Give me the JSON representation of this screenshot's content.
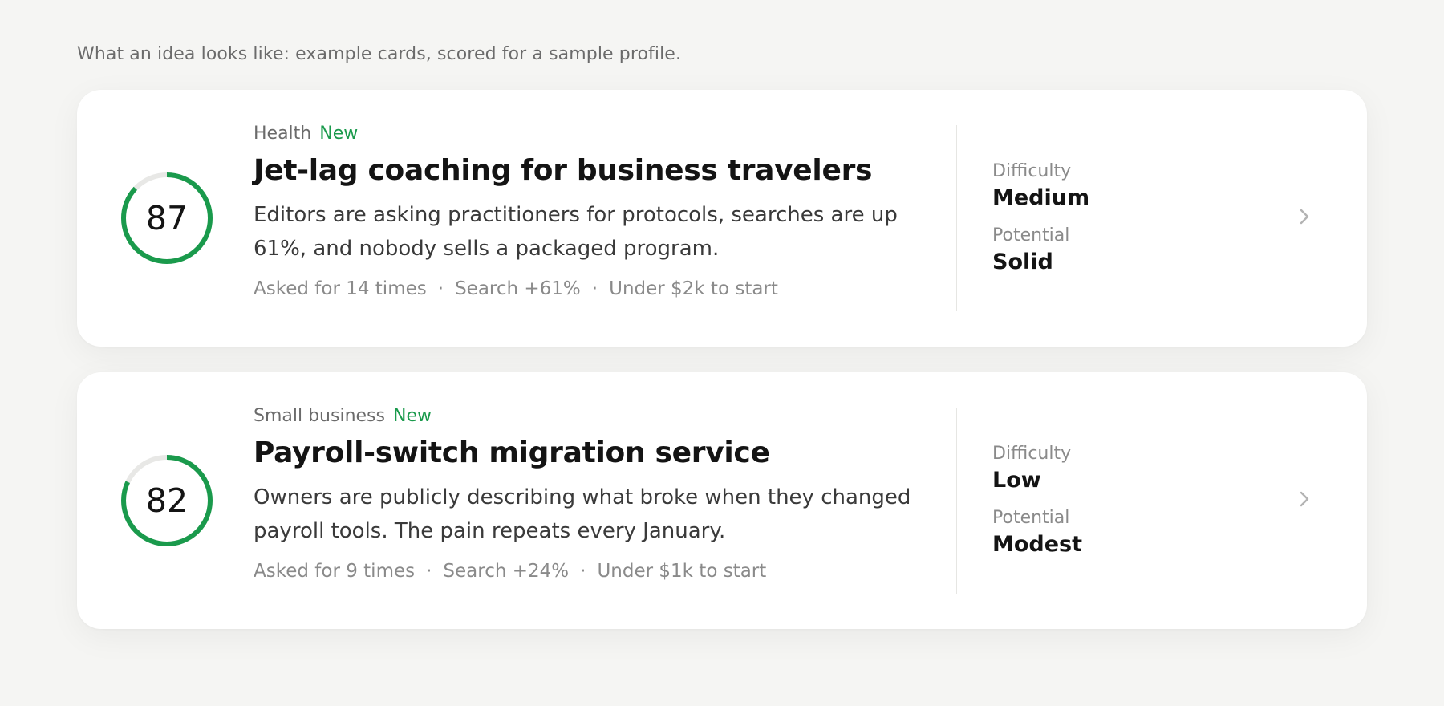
{
  "intro": "What an idea looks like: example cards, scored for a sample profile.",
  "colors": {
    "accent_green": "#1a9a4c",
    "ring_track": "#e8e8e6",
    "background": "#f5f5f3"
  },
  "labels": {
    "difficulty": "Difficulty",
    "potential": "Potential",
    "separator": "·"
  },
  "icons": {
    "open": "chevron-right-icon"
  },
  "cards": [
    {
      "score": 87,
      "category": "Health",
      "badge": "New",
      "title": "Jet-lag coaching for business travelers",
      "description": "Editors are asking practitioners for protocols, searches are up 61%, and nobody sells a packaged program.",
      "meta": [
        "Asked for 14 times",
        "Search +61%",
        "Under $2k to start"
      ],
      "difficulty": "Medium",
      "potential": "Solid"
    },
    {
      "score": 82,
      "category": "Small business",
      "badge": "New",
      "title": "Payroll-switch migration service",
      "description": "Owners are publicly describing what broke when they changed payroll tools. The pain repeats every January.",
      "meta": [
        "Asked for 9 times",
        "Search +24%",
        "Under $1k to start"
      ],
      "difficulty": "Low",
      "potential": "Modest"
    }
  ]
}
